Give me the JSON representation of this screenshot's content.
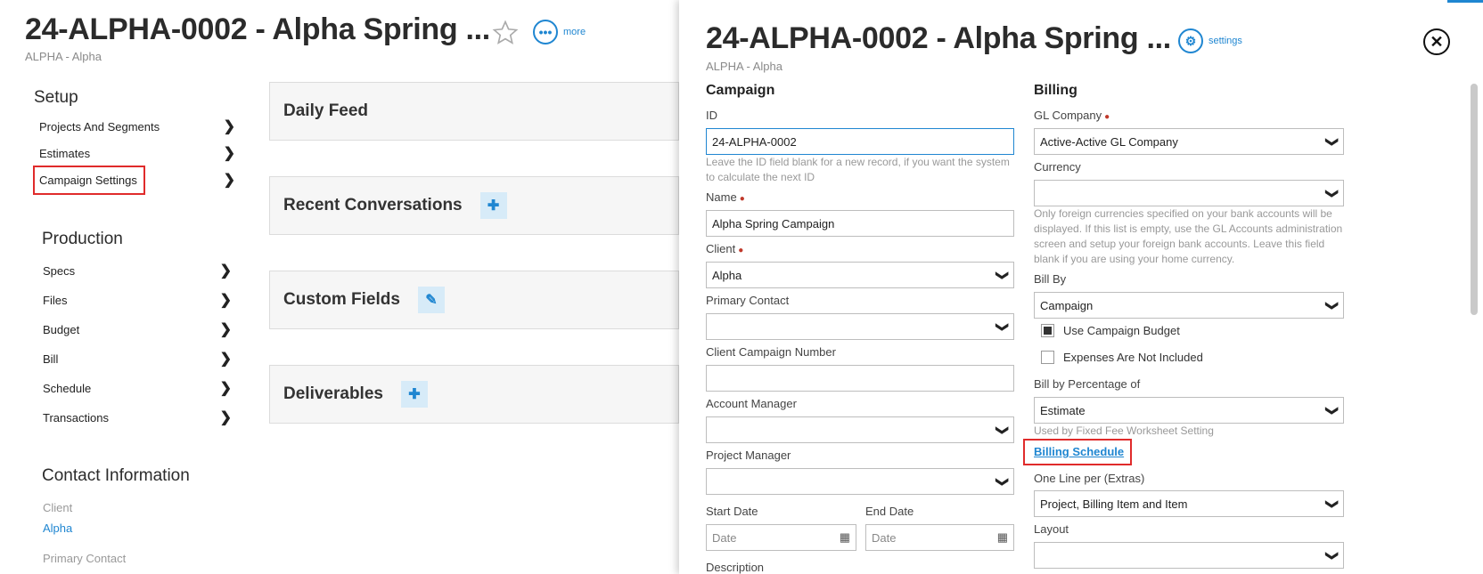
{
  "left": {
    "title": "24-ALPHA-0002 - Alpha Spring ...",
    "subtitle": "ALPHA - Alpha",
    "more_label": "more",
    "setup": {
      "heading": "Setup",
      "items": [
        "Projects And Segments",
        "Estimates",
        "Campaign Settings"
      ]
    },
    "production": {
      "heading": "Production",
      "items": [
        "Specs",
        "Files",
        "Budget",
        "Bill",
        "Schedule",
        "Transactions"
      ]
    },
    "panels": [
      "Daily Feed",
      "Recent Conversations",
      "Custom Fields",
      "Deliverables"
    ],
    "contact": {
      "heading": "Contact Information",
      "client_label": "Client",
      "client_value": "Alpha",
      "primary_contact_label": "Primary Contact"
    }
  },
  "drawer": {
    "title": "24-ALPHA-0002 - Alpha Spring ...",
    "subtitle": "ALPHA - Alpha",
    "settings_label": "settings",
    "campaign": {
      "heading": "Campaign",
      "id_label": "ID",
      "id_value": "24-ALPHA-0002",
      "id_help": "Leave the ID field blank for a new record, if you want the system to calculate the next ID",
      "name_label": "Name",
      "name_value": "Alpha Spring Campaign",
      "client_label": "Client",
      "client_value": "Alpha",
      "primary_contact_label": "Primary Contact",
      "client_campaign_number_label": "Client Campaign Number",
      "account_manager_label": "Account Manager",
      "project_manager_label": "Project Manager",
      "start_date_label": "Start Date",
      "start_date_placeholder": "Date",
      "end_date_label": "End Date",
      "end_date_placeholder": "Date",
      "description_label": "Description"
    },
    "billing": {
      "heading": "Billing",
      "gl_company_label": "GL Company",
      "gl_company_value": "Active-Active GL Company",
      "currency_label": "Currency",
      "currency_help": "Only foreign currencies specified on your bank accounts will be displayed. If this list is empty, use the GL Accounts administration screen and setup your foreign bank accounts. Leave this field blank if you are using your home currency.",
      "bill_by_label": "Bill By",
      "bill_by_value": "Campaign",
      "use_campaign_budget_label": "Use Campaign Budget",
      "use_campaign_budget_checked": true,
      "expenses_not_included_label": "Expenses Are Not Included",
      "expenses_not_included_checked": false,
      "bill_by_pct_label": "Bill by Percentage of",
      "bill_by_pct_value": "Estimate",
      "bill_by_pct_help": "Used by Fixed Fee Worksheet Setting",
      "billing_schedule_link": "Billing Schedule",
      "one_line_label": "One Line per (Extras)",
      "one_line_value": "Project, Billing Item and Item",
      "layout_label": "Layout"
    }
  }
}
